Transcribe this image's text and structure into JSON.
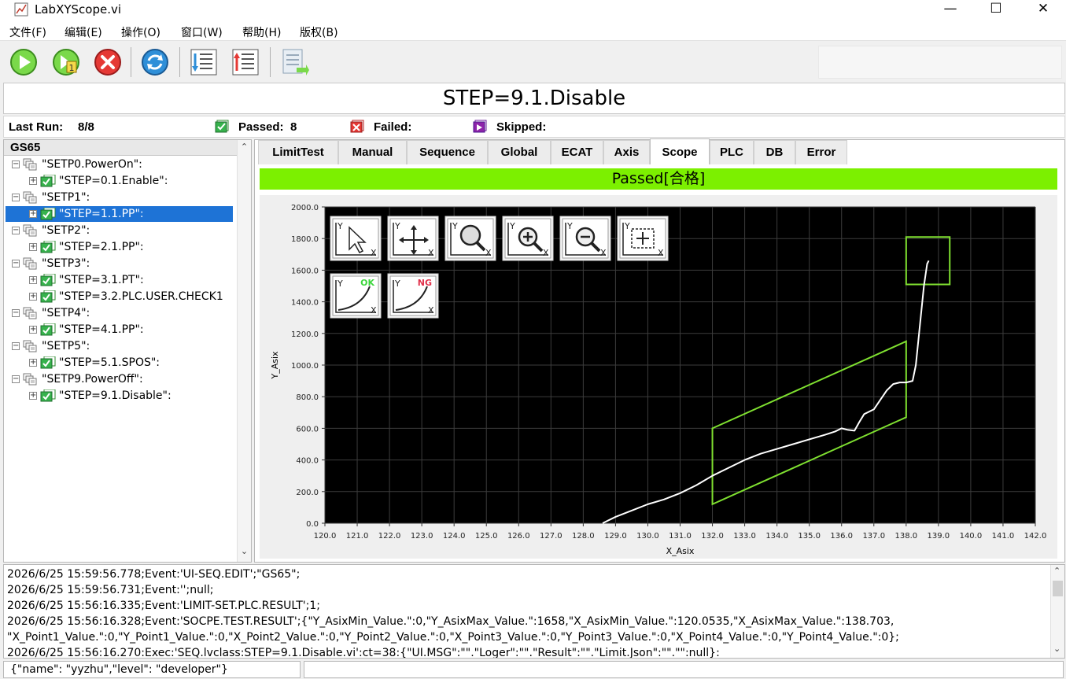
{
  "window": {
    "title": "LabXYScope.vi",
    "minimize": "—",
    "maximize": "☐",
    "close": "✕"
  },
  "menu": [
    "文件(F)",
    "编辑(E)",
    "操作(O)",
    "窗口(W)",
    "帮助(H)",
    "版权(B)"
  ],
  "toolbar": {
    "buttons": [
      "run-icon",
      "step-icon",
      "stop-icon",
      "refresh-icon",
      "import-icon",
      "export-icon",
      "report-icon"
    ]
  },
  "step_banner": "STEP=9.1.Disable",
  "summary": {
    "last_run_label": "Last Run:",
    "last_run_value": "8/8",
    "passed_label": "Passed:",
    "passed_value": "8",
    "failed_label": "Failed:",
    "failed_value": "",
    "skipped_label": "Skipped:",
    "skipped_value": ""
  },
  "tree": {
    "root": "GS65",
    "nodes": [
      {
        "label": "\"SETP0.PowerOn\":",
        "level": 0,
        "expander": "⊟",
        "selected": false
      },
      {
        "label": "\"STEP=0.1.Enable\":",
        "level": 1,
        "expander": "⊞",
        "selected": false
      },
      {
        "label": "\"SETP1\":",
        "level": 0,
        "expander": "⊟",
        "selected": false
      },
      {
        "label": "\"STEP=1.1.PP\":",
        "level": 1,
        "expander": "⊞",
        "selected": true
      },
      {
        "label": "\"SETP2\":",
        "level": 0,
        "expander": "⊟",
        "selected": false
      },
      {
        "label": "\"STEP=2.1.PP\":",
        "level": 1,
        "expander": "⊞",
        "selected": false
      },
      {
        "label": "\"SETP3\":",
        "level": 0,
        "expander": "⊟",
        "selected": false
      },
      {
        "label": "\"STEP=3.1.PT\":",
        "level": 1,
        "expander": "⊞",
        "selected": false
      },
      {
        "label": "\"STEP=3.2.PLC.USER.CHECK1",
        "level": 1,
        "expander": "⊞",
        "selected": false
      },
      {
        "label": "\"SETP4\":",
        "level": 0,
        "expander": "⊟",
        "selected": false
      },
      {
        "label": "\"STEP=4.1.PP\":",
        "level": 1,
        "expander": "⊞",
        "selected": false
      },
      {
        "label": "\"SETP5\":",
        "level": 0,
        "expander": "⊟",
        "selected": false
      },
      {
        "label": "\"STEP=5.1.SPOS\":",
        "level": 1,
        "expander": "⊞",
        "selected": false
      },
      {
        "label": "\"SETP9.PowerOff\":",
        "level": 0,
        "expander": "⊟",
        "selected": false
      },
      {
        "label": "\"STEP=9.1.Disable\":",
        "level": 1,
        "expander": "⊞",
        "selected": false
      }
    ]
  },
  "tabs": [
    "LimitTest",
    "Manual",
    "Sequence",
    "Global",
    "ECAT",
    "Axis",
    "Scope",
    "PLC",
    "DB",
    "Error"
  ],
  "active_tab": "Scope",
  "result_banner": "Passed[合格]",
  "plot_tools": {
    "top_row": [
      "cursor-tool-icon",
      "pan-tool-icon",
      "zoom-fit-tool-icon",
      "zoom-in-tool-icon",
      "zoom-out-tool-icon",
      "zoom-box-tool-icon"
    ],
    "second_row": [
      {
        "icon": "ok-curve-icon",
        "label": "OK"
      },
      {
        "icon": "ng-curve-icon",
        "label": "NG"
      }
    ],
    "axis_letter_y": "Y",
    "axis_letter_x": "X"
  },
  "chart_data": {
    "type": "line",
    "xlabel": "X_Asix",
    "ylabel": "Y_Asix",
    "xlim": [
      120,
      142
    ],
    "ylim": [
      0,
      2000
    ],
    "x_ticks": [
      "120.0",
      "121.0",
      "122.0",
      "123.0",
      "124.0",
      "125.0",
      "126.0",
      "127.0",
      "128.0",
      "129.0",
      "130.0",
      "131.0",
      "132.0",
      "133.0",
      "134.0",
      "135.0",
      "136.0",
      "137.0",
      "138.0",
      "139.0",
      "140.0",
      "141.0",
      "142.0"
    ],
    "y_ticks": [
      "0.0",
      "200.0",
      "400.0",
      "600.0",
      "800.0",
      "1000.0",
      "1200.0",
      "1400.0",
      "1600.0",
      "1800.0",
      "2000.0"
    ],
    "grid": true,
    "background": "#000000",
    "series": [
      {
        "color": "#ffffff",
        "x": [
          128.6,
          129.0,
          129.5,
          130.0,
          130.5,
          131.0,
          131.5,
          132.0,
          132.5,
          133.0,
          133.5,
          134.0,
          134.5,
          135.0,
          135.5,
          135.8,
          136.0,
          136.2,
          136.4,
          136.55,
          136.7,
          137.0,
          137.2,
          137.4,
          137.6,
          137.8,
          138.0,
          138.2,
          138.3,
          138.4,
          138.5,
          138.55,
          138.65,
          138.7
        ],
        "y": [
          0,
          40,
          80,
          120,
          150,
          190,
          240,
          300,
          350,
          400,
          440,
          470,
          500,
          530,
          560,
          580,
          600,
          590,
          585,
          640,
          690,
          720,
          780,
          840,
          880,
          890,
          890,
          900,
          1000,
          1200,
          1400,
          1500,
          1640,
          1660
        ]
      }
    ],
    "limit_boxes": [
      {
        "shape": "parallelogram",
        "color": "#7fe030",
        "points": [
          [
            132.0,
            600
          ],
          [
            138.0,
            1150
          ],
          [
            138.0,
            670
          ],
          [
            132.0,
            120
          ]
        ]
      },
      {
        "shape": "rectangle",
        "color": "#7fe030",
        "points": [
          [
            138.0,
            1810
          ],
          [
            139.35,
            1810
          ],
          [
            139.35,
            1510
          ],
          [
            138.0,
            1510
          ]
        ]
      }
    ]
  },
  "log": [
    "2026/6/25 15:59:56.778;Event:'UI-SEQ.EDIT';\"GS65\";",
    "2026/6/25 15:59:56.731;Event:'';null;",
    "2026/6/25 15:56:16.335;Event:'LIMIT-SET.PLC.RESULT';1;",
    "2026/6/25 15:56:16.328;Event:'SOCPE.TEST.RESULT';{\"Y_AsixMin_Value.\":0,\"Y_AsixMax_Value.\":1658,\"X_AsixMin_Value.\":120.0535,\"X_AsixMax_Value.\":138.703,",
    "\"X_Point1_Value.\":0,\"Y_Point1_Value.\":0,\"X_Point2_Value.\":0,\"Y_Point2_Value.\":0,\"X_Point3_Value.\":0,\"Y_Point3_Value.\":0,\"X_Point4_Value.\":0,\"Y_Point4_Value.\":0};",
    "2026/6/25 15:56:16.270:Exec:'SEQ.lvclass:STEP=9.1.Disable.vi':ct=38:{\"UI.MSG\":\"\".\"Loger\":\"\".\"Result\":\"\".\"Limit.Json\":\"\".\"\":null}:"
  ],
  "status": {
    "user": "{\"name\": \"yyzhu\",\"level\": \"developer\"}"
  },
  "colors": {
    "pass": "#7cf000",
    "selection": "#1e73d6",
    "limit": "#7fe030"
  }
}
